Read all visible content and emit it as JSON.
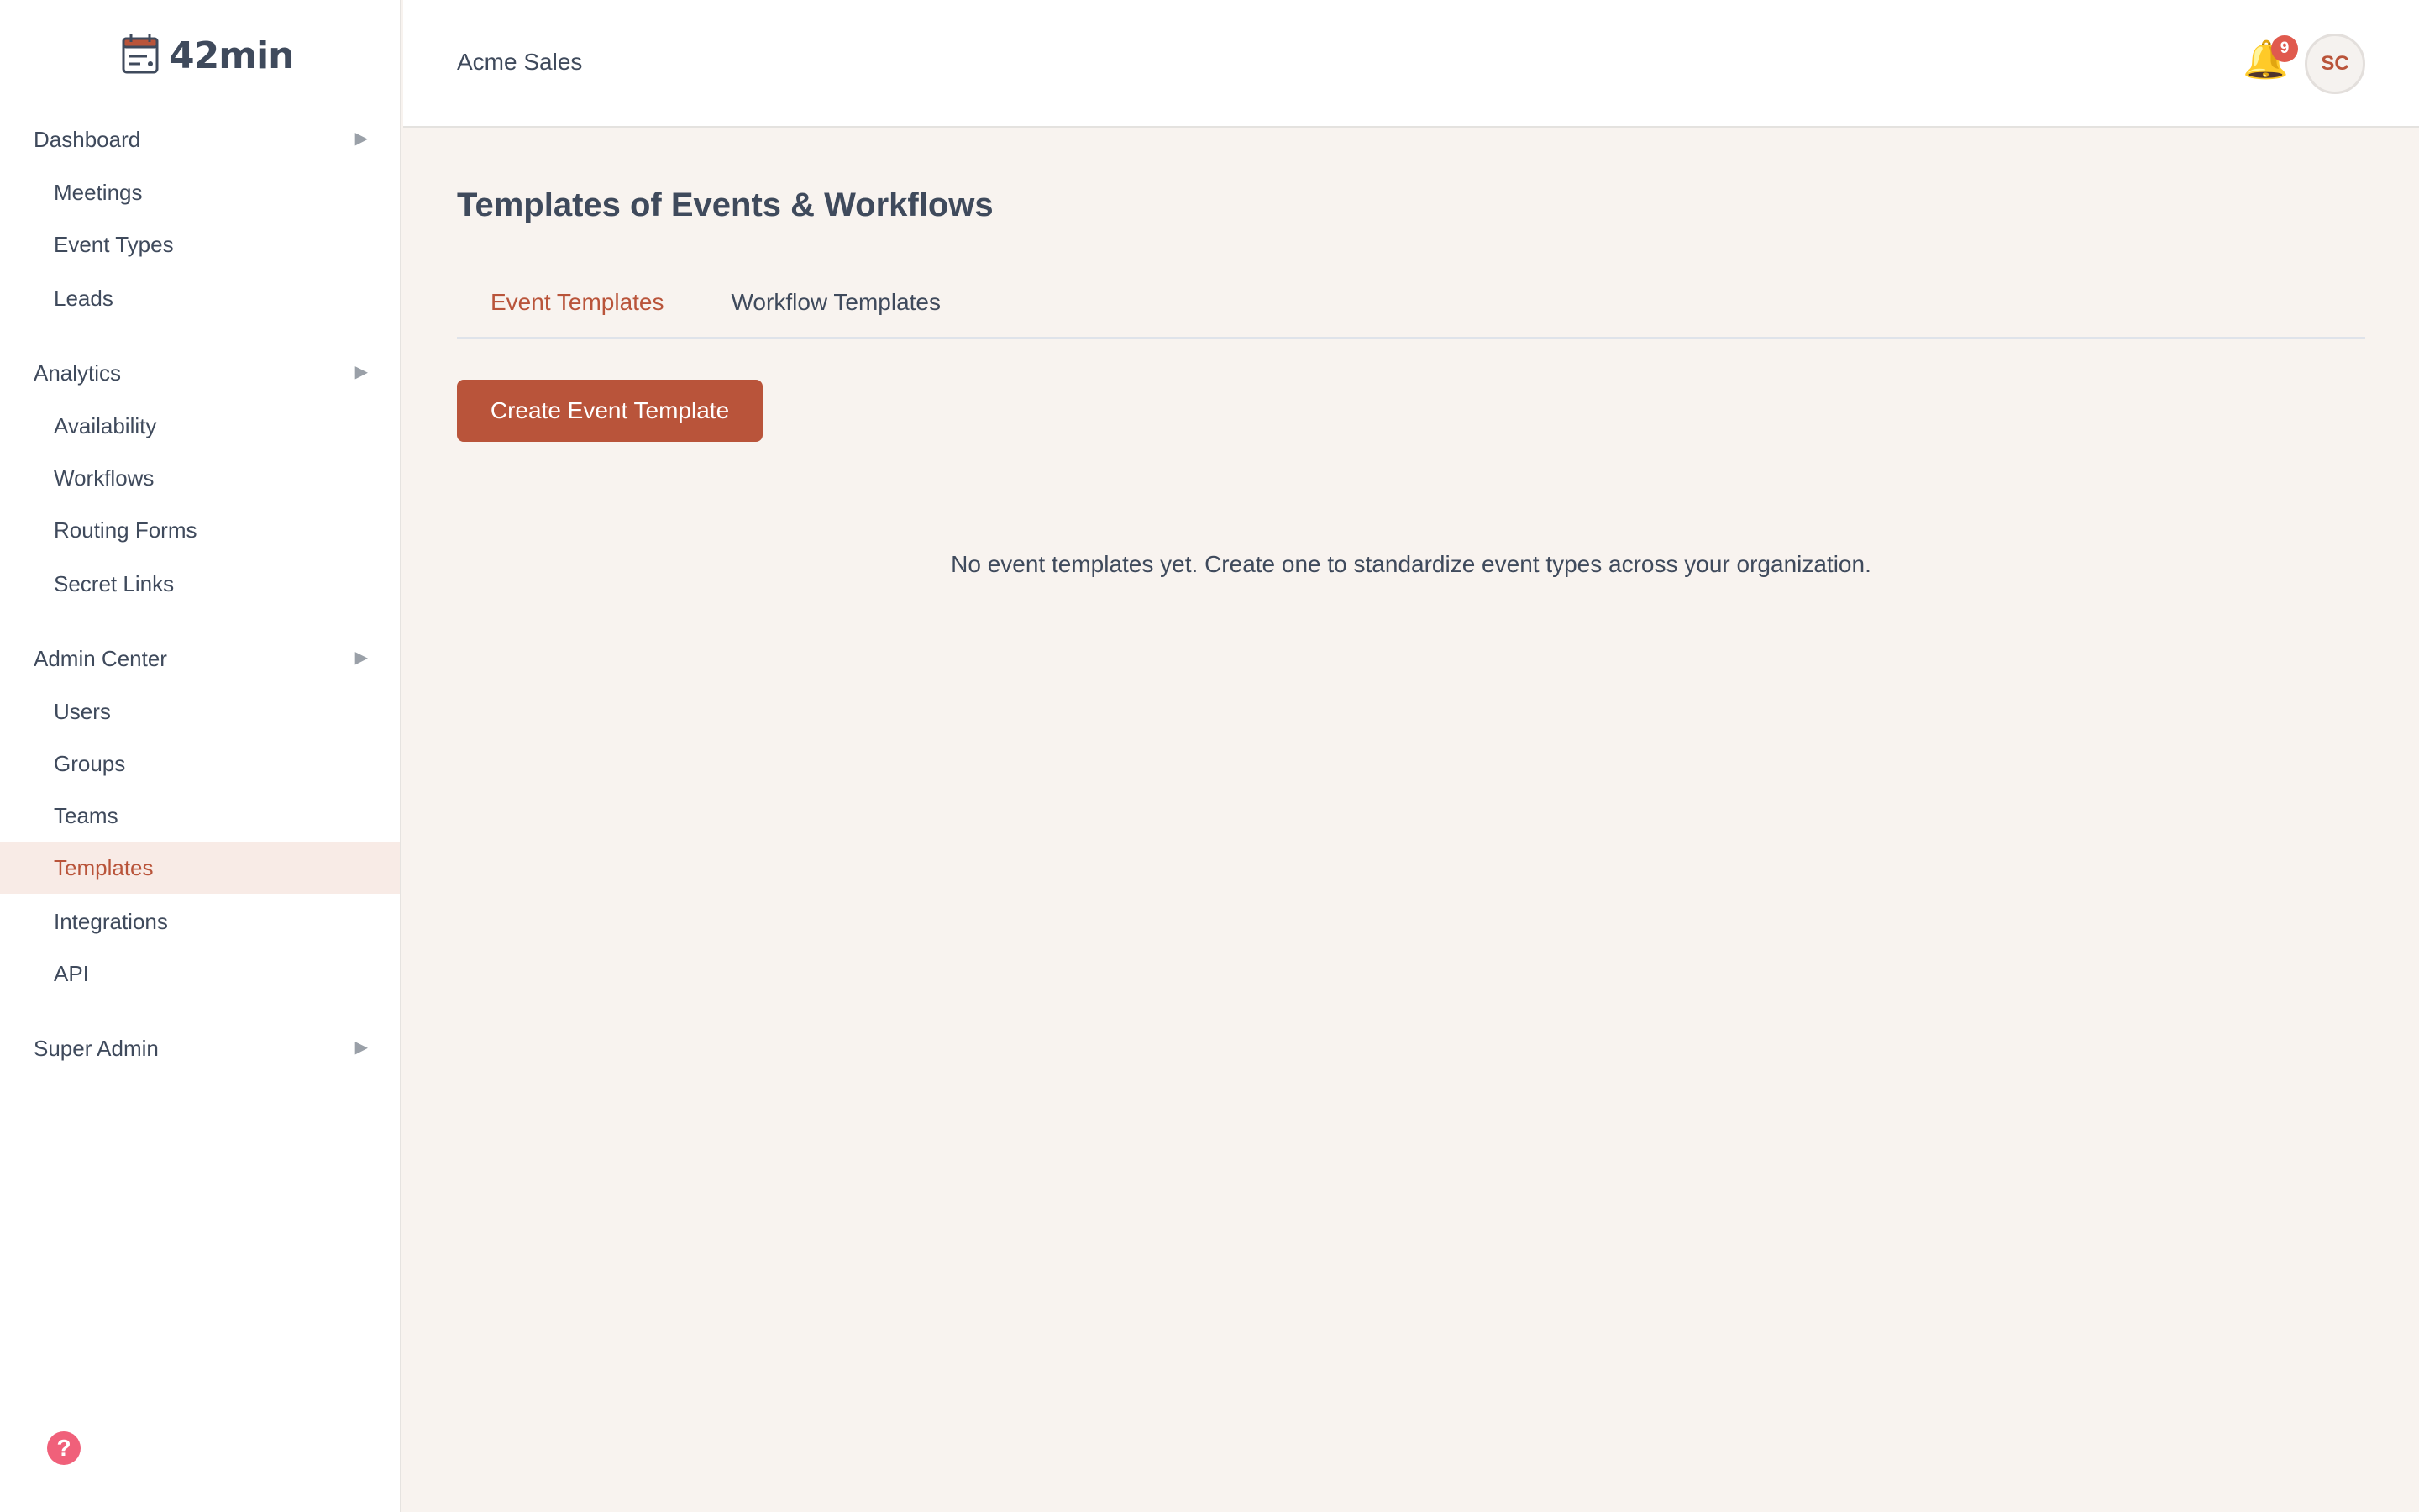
{
  "app": {
    "logo_text": "42min"
  },
  "header": {
    "org_name": "Acme Sales",
    "notification_count": "9",
    "avatar_initials": "SC"
  },
  "sidebar": {
    "sections": [
      {
        "label": "Dashboard",
        "items": [
          "Meetings",
          "Event Types",
          "Leads"
        ]
      },
      {
        "label": "Analytics",
        "items": [
          "Availability",
          "Workflows",
          "Routing Forms",
          "Secret Links"
        ]
      },
      {
        "label": "Admin Center",
        "items": [
          "Users",
          "Groups",
          "Teams",
          "Templates",
          "Integrations",
          "API"
        ]
      },
      {
        "label": "Super Admin",
        "items": []
      }
    ],
    "active_item": "Templates",
    "help_icon": "question-circle-icon"
  },
  "main": {
    "title": "Templates of Events & Workflows",
    "tabs": [
      {
        "label": "Event Templates",
        "active": true
      },
      {
        "label": "Workflow Templates",
        "active": false
      }
    ],
    "create_button": "Create Event Template",
    "empty_message": "No event templates yet. Create one to standardize event types across your organization."
  },
  "colors": {
    "accent": "#b9543a",
    "active_bg": "#f8ebe6",
    "page_bg": "#f8f3ef",
    "text": "#3f4a5c",
    "badge": "#e05a4e"
  }
}
